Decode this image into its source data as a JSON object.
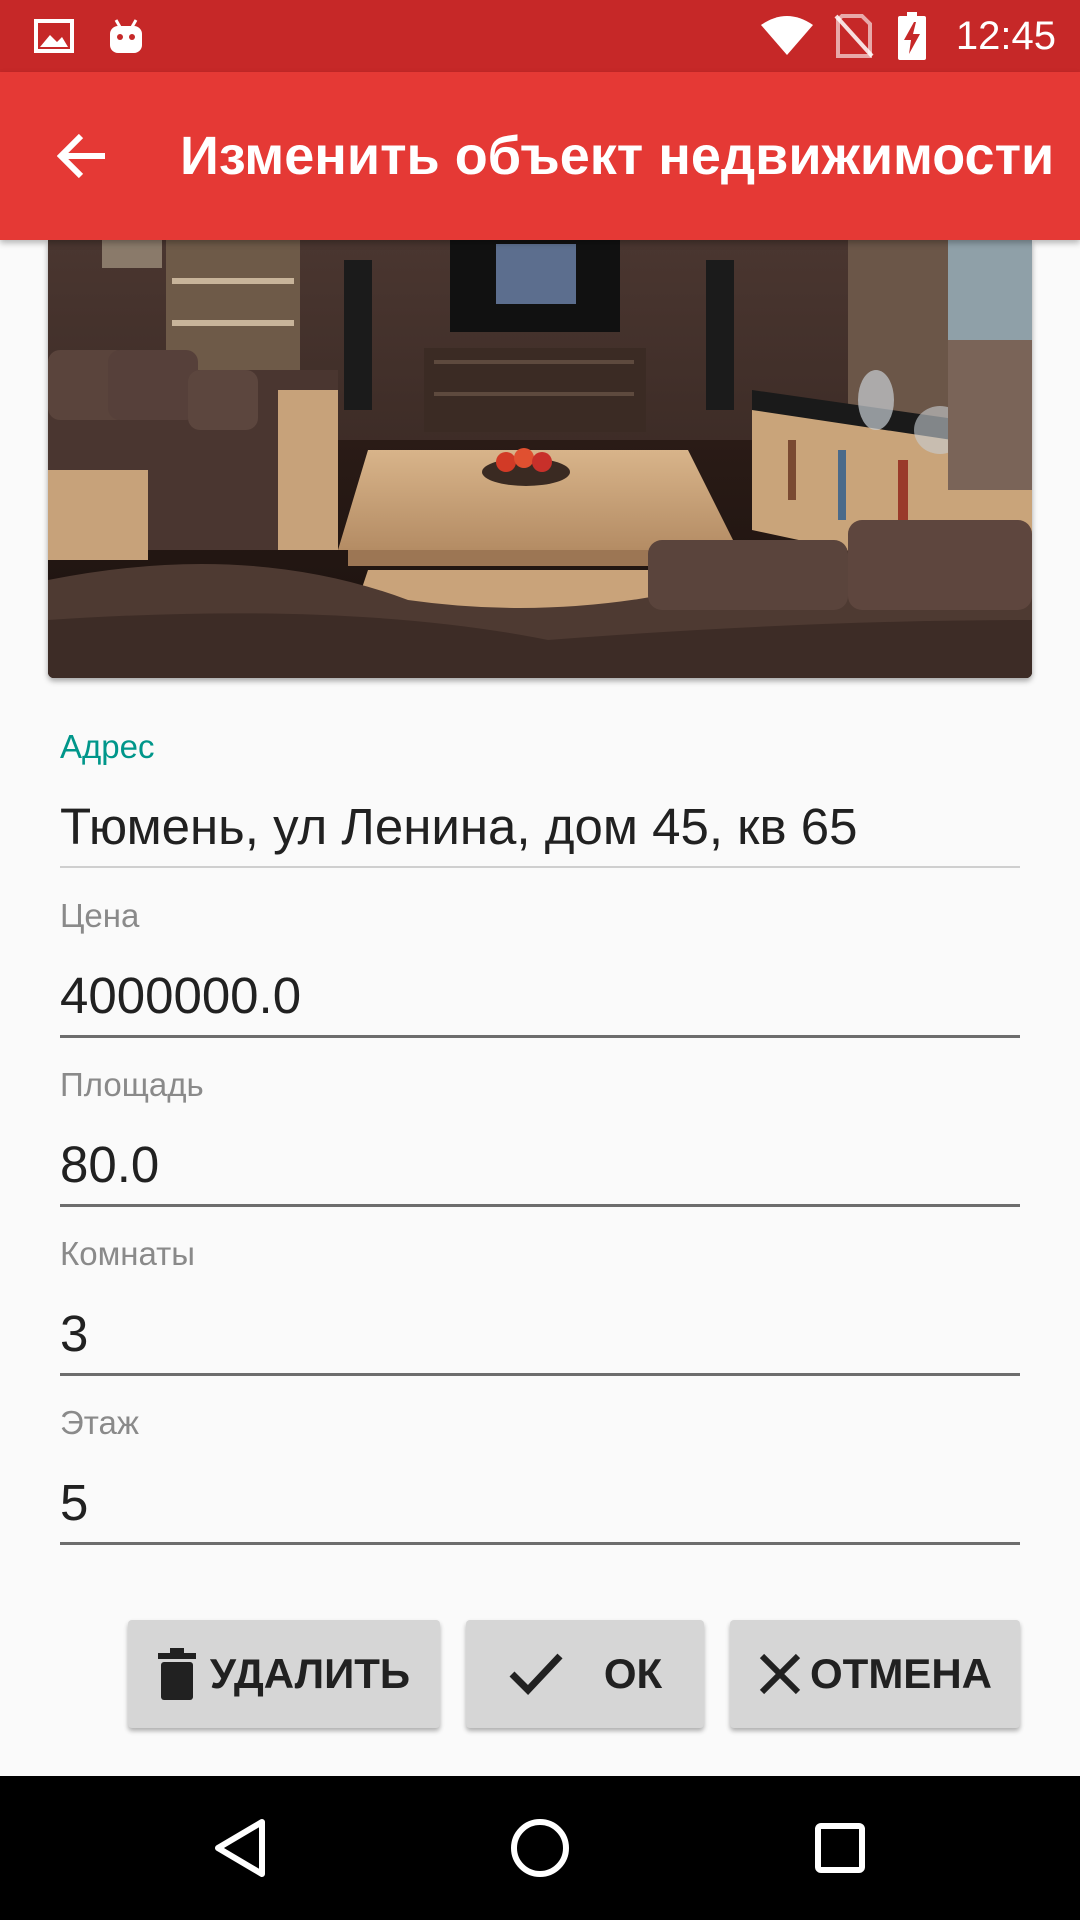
{
  "status_bar": {
    "time": "12:45",
    "left_icons": [
      "image-icon",
      "android-icon"
    ],
    "right_icons": [
      "wifi-icon",
      "no-sim-icon",
      "battery-charging-icon"
    ]
  },
  "app_bar": {
    "title": "Изменить объект недвижимости",
    "back_icon": "arrow-back-icon",
    "color": "#e53935"
  },
  "form": {
    "address": {
      "label": "Адрес",
      "value": "Тюмень, ул Ленина, дом 45, кв 65"
    },
    "price": {
      "label": "Цена",
      "value": "4000000.0"
    },
    "area": {
      "label": "Площадь",
      "value": "80.0"
    },
    "rooms": {
      "label": "Комнаты",
      "value": "3"
    },
    "floor": {
      "label": "Этаж",
      "value": "5"
    }
  },
  "buttons": {
    "delete": {
      "label": "УДАЛИТЬ",
      "icon": "trash-icon"
    },
    "ok": {
      "label": "ОК",
      "icon": "check-icon"
    },
    "cancel": {
      "label": "ОТМЕНА",
      "icon": "close-icon"
    }
  },
  "nav_bar": {
    "icons": [
      "back-triangle-icon",
      "home-circle-icon",
      "recents-square-icon"
    ]
  },
  "colors": {
    "status_bar": "#c62828",
    "app_bar": "#e53935",
    "accent": "#00968a"
  }
}
